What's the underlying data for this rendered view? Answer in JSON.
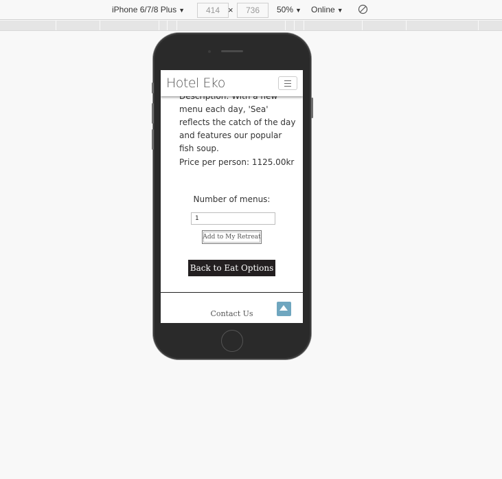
{
  "toolbar": {
    "device_label": "iPhone 6/7/8 Plus",
    "width_value": "414",
    "height_value": "736",
    "times_symbol": "×",
    "zoom_label": "50%",
    "network_label": "Online"
  },
  "header": {
    "logo": "Hotel Eko"
  },
  "content": {
    "description": "Description: With a new menu each day, 'Sea' reflects the catch of the day and features our popular fish soup.",
    "price": "Price per person: 1125.00kr",
    "number_label": "Number of menus:",
    "number_value": "1",
    "add_button": "Add to My Retreat",
    "back_button": "Back to Eat Options",
    "contact_link": "Contact Us"
  },
  "icons": {
    "menu": "hamburger-icon",
    "scroll_top": "arrow-up-icon",
    "rotate": "rotate-icon"
  },
  "colors": {
    "back_button_bg": "#231f20",
    "scroll_top_bg": "#6fa6bf",
    "phone_body": "#2a2a2a"
  }
}
